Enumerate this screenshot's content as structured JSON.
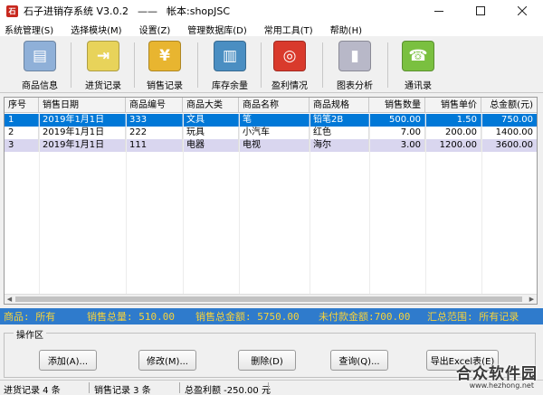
{
  "window": {
    "title": "石子进销存系统 V3.0.2",
    "separator": "——",
    "account": "帐本:shopJSC",
    "icon_glyph": "石",
    "min_icon": "minimize-icon",
    "max_icon": "maximize-icon",
    "close_icon": "close-icon"
  },
  "menu": [
    "系统管理(S)",
    "选择模块(M)",
    "设置(Z)",
    "管理数据库(D)",
    "常用工具(T)",
    "帮助(H)"
  ],
  "toolbar": [
    {
      "label": "商品信息",
      "icon": "product-info-icon",
      "color": "#8fb0d8",
      "glyph": "▤"
    },
    {
      "label": "进货记录",
      "icon": "purchase-record-icon",
      "color": "#e8d35a",
      "glyph": "⇥"
    },
    {
      "label": "销售记录",
      "icon": "sales-record-icon",
      "color": "#e8b530",
      "glyph": "¥"
    },
    {
      "label": "库存余量",
      "icon": "inventory-icon",
      "color": "#4a8ec2",
      "glyph": "▥"
    },
    {
      "label": "盈利情况",
      "icon": "profit-icon",
      "color": "#d93a2c",
      "glyph": "◎"
    },
    {
      "label": "图表分析",
      "icon": "chart-analysis-icon",
      "color": "#b8b8c8",
      "glyph": "▮"
    },
    {
      "label": "通讯录",
      "icon": "address-book-icon",
      "color": "#7ac040",
      "glyph": "☎"
    }
  ],
  "table": {
    "columns": [
      "序号",
      "销售日期",
      "商品编号",
      "商品大类",
      "商品名称",
      "商品规格",
      "销售数量",
      "销售单价",
      "总金额(元)"
    ],
    "rows": [
      [
        "1",
        "2019年1月1日",
        "333",
        "文具",
        "笔",
        "铅笔2B",
        "500.00",
        "1.50",
        "750.00"
      ],
      [
        "2",
        "2019年1月1日",
        "222",
        "玩具",
        "小汽车",
        "红色",
        "7.00",
        "200.00",
        "1400.00"
      ],
      [
        "3",
        "2019年1月1日",
        "111",
        "电器",
        "电视",
        "海尔",
        "3.00",
        "1200.00",
        "3600.00"
      ]
    ],
    "selected_row": 0
  },
  "summary": {
    "product": "商品: 所有",
    "total_qty": "销售总量: 510.00",
    "total_amount": "销售总金额: 5750.00",
    "unpaid": "未付款金额:700.00",
    "range": "汇总范围: 所有记录"
  },
  "operations": {
    "title": "操作区",
    "buttons": [
      "添加(A)...",
      "修改(M)...",
      "删除(D)",
      "查询(Q)...",
      "导出Excel表(E)"
    ]
  },
  "status": {
    "purchase": "进货记录 4 条",
    "sales": "销售记录 3 条",
    "profit": "总盈利额 -250.00 元"
  },
  "watermark": {
    "main": "合众软件园",
    "url": "www.hezhong.net"
  }
}
